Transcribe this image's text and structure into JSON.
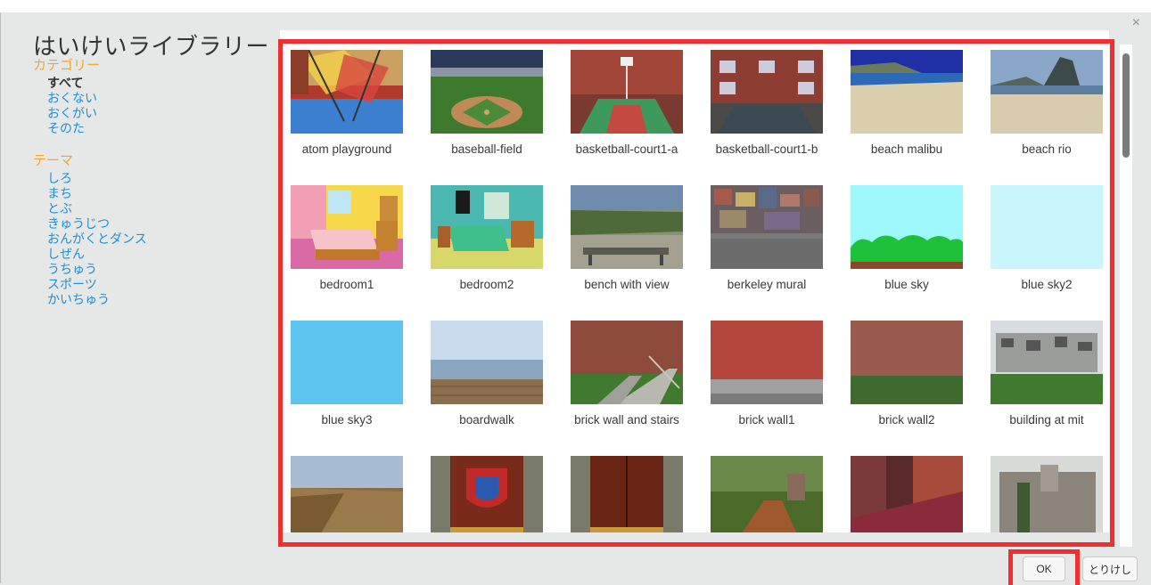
{
  "dialog": {
    "title": "はいけいライブラリー",
    "close_glyph": "×",
    "ok_label": "OK",
    "cancel_label": "とりけし"
  },
  "sidebar": {
    "category_label": "カテゴリー",
    "categories": [
      "すべて",
      "おくない",
      "おくがい",
      "そのた"
    ],
    "selected_category": "すべて",
    "theme_label": "テーマ",
    "themes": [
      "しろ",
      "まち",
      "とぶ",
      "きゅうじつ",
      "おんがくとダンス",
      "しぜん",
      "うちゅう",
      "スポーツ",
      "かいちゅう"
    ]
  },
  "colors": {
    "accent_orange": "#f7a32d",
    "link_blue": "#1e8fd6",
    "highlight_red": "#f03030"
  },
  "backdrops": [
    {
      "name": "atom playground"
    },
    {
      "name": "baseball-field"
    },
    {
      "name": "basketball-court1-a"
    },
    {
      "name": "basketball-court1-b"
    },
    {
      "name": "beach malibu"
    },
    {
      "name": "beach rio"
    },
    {
      "name": "bedroom1"
    },
    {
      "name": "bedroom2"
    },
    {
      "name": "bench with view"
    },
    {
      "name": "berkeley mural"
    },
    {
      "name": "blue sky"
    },
    {
      "name": "blue sky2"
    },
    {
      "name": "blue sky3"
    },
    {
      "name": "boardwalk"
    },
    {
      "name": "brick wall and stairs"
    },
    {
      "name": "brick wall1"
    },
    {
      "name": "brick wall2"
    },
    {
      "name": "building at mit"
    },
    {
      "name": ""
    },
    {
      "name": ""
    },
    {
      "name": ""
    },
    {
      "name": ""
    },
    {
      "name": ""
    },
    {
      "name": ""
    }
  ]
}
